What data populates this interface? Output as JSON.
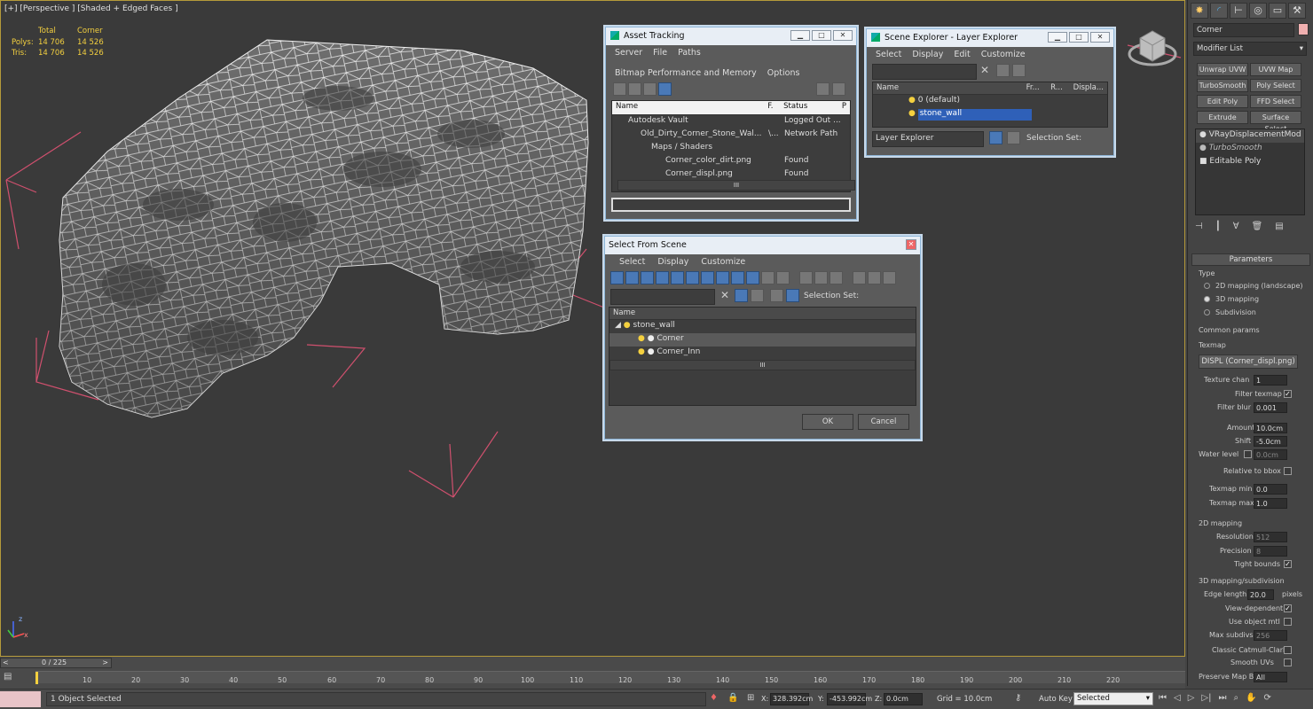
{
  "viewport": {
    "label": "[+] [Perspective ] [Shaded + Edged Faces ]",
    "stats": {
      "col_total": "Total",
      "col_corner": "Corner",
      "polys_label": "Polys:",
      "polys_total": "14 706",
      "polys_corner": "14 526",
      "tris_label": "Tris:",
      "tris_total": "14 706",
      "tris_corner": "14 526"
    },
    "axis_z": "z",
    "axis_x": "x"
  },
  "asset_tracking": {
    "title": "Asset Tracking",
    "menu": [
      "Server",
      "File",
      "Paths",
      "Bitmap Performance and Memory",
      "Options"
    ],
    "columns": [
      "Name",
      "F.",
      "Status",
      "P"
    ],
    "rows": [
      {
        "name": "Autodesk Vault",
        "f": "",
        "status": "Logged Out ..."
      },
      {
        "name": "Old_Dirty_Corner_Stone_Wal...",
        "f": "\\...",
        "status": "Network Path"
      },
      {
        "name": "Maps / Shaders",
        "f": "",
        "status": ""
      },
      {
        "name": "Corner_color_dirt.png",
        "f": "",
        "status": "Found"
      },
      {
        "name": "Corner_displ.png",
        "f": "",
        "status": "Found"
      }
    ],
    "scroll_grip": "III"
  },
  "scene_explorer": {
    "title": "Scene Explorer - Layer Explorer",
    "menu": [
      "Select",
      "Display",
      "Edit",
      "Customize"
    ],
    "columns": [
      "Name",
      "Fr...",
      "R...",
      "Displa..."
    ],
    "rows": [
      "0 (default)",
      "stone_wall"
    ],
    "footer_dropdown": "Layer Explorer",
    "selection_set": "Selection Set:"
  },
  "select_from_scene": {
    "title": "Select From Scene",
    "menu": [
      "Select",
      "Display",
      "Customize"
    ],
    "selection_set": "Selection Set:",
    "column": "Name",
    "rows": [
      "stone_wall",
      "Corner",
      "Corner_Inn"
    ],
    "scroll_grip": "III",
    "ok": "OK",
    "cancel": "Cancel"
  },
  "command_panel": {
    "object_name": "Corner",
    "modifier_list": "Modifier List",
    "mod_buttons": [
      "Unwrap UVW",
      "UVW Map",
      "TurboSmooth",
      "Poly Select",
      "Edit Poly",
      "FFD Select",
      "Extrude",
      "Surface Select"
    ],
    "stack": [
      "VRayDisplacementMod",
      "TurboSmooth",
      "Editable Poly"
    ],
    "rollout": "Parameters",
    "type_label": "Type",
    "type_options": [
      "2D mapping (landscape)",
      "3D mapping",
      "Subdivision"
    ],
    "common_params": "Common params",
    "texmap": "Texmap",
    "texmap_value": "DISPL (Corner_displ.png)",
    "texture_chan_label": "Texture chan",
    "texture_chan": "1",
    "filter_texmap": "Filter texmap",
    "filter_blur_label": "Filter blur",
    "filter_blur": "0.001",
    "amount_label": "Amount",
    "amount": "10.0cm",
    "shift_label": "Shift",
    "shift": "-5.0cm",
    "water_level_label": "Water level",
    "water_level": "0.0cm",
    "relative_bbox": "Relative to bbox",
    "texmap_min_label": "Texmap min",
    "texmap_min": "0.0",
    "texmap_max_label": "Texmap max",
    "texmap_max": "1.0",
    "map2d": "2D mapping",
    "resolution_label": "Resolution",
    "resolution": "512",
    "precision_label": "Precision",
    "precision": "8",
    "tight_bounds": "Tight bounds",
    "map3d": "3D mapping/subdivision",
    "edge_length_label": "Edge length",
    "edge_length": "20.0",
    "pixels": "pixels",
    "view_dependent": "View-dependent",
    "use_object_mtl": "Use object mtl",
    "max_subdivs_label": "Max subdivs",
    "max_subdivs": "256",
    "classic_catmull": "Classic Catmull-Clark",
    "smooth_uvs": "Smooth UVs",
    "preserve_map_bnd": "Preserve Map Bnd",
    "preserve_value": "All"
  },
  "timeline": {
    "frame": "0 / 225",
    "ticks": [
      "10",
      "20",
      "30",
      "40",
      "50",
      "60",
      "70",
      "80",
      "90",
      "100",
      "110",
      "120",
      "130",
      "140",
      "150",
      "160",
      "170",
      "180",
      "190",
      "200",
      "210",
      "220"
    ]
  },
  "status": {
    "selected": "1 Object Selected",
    "x_label": "X:",
    "x": "328.392cm",
    "y_label": "Y:",
    "y": "-453.992cm",
    "z_label": "Z:",
    "z": "0.0cm",
    "grid": "Grid = 10.0cm",
    "auto_key": "Auto Key",
    "key_mode": "Selected"
  },
  "colors": {
    "accent": "#2f60b8",
    "stats": "#f4d03f",
    "viewport_border": "#b59a3a",
    "bbox": "#d0506e"
  }
}
